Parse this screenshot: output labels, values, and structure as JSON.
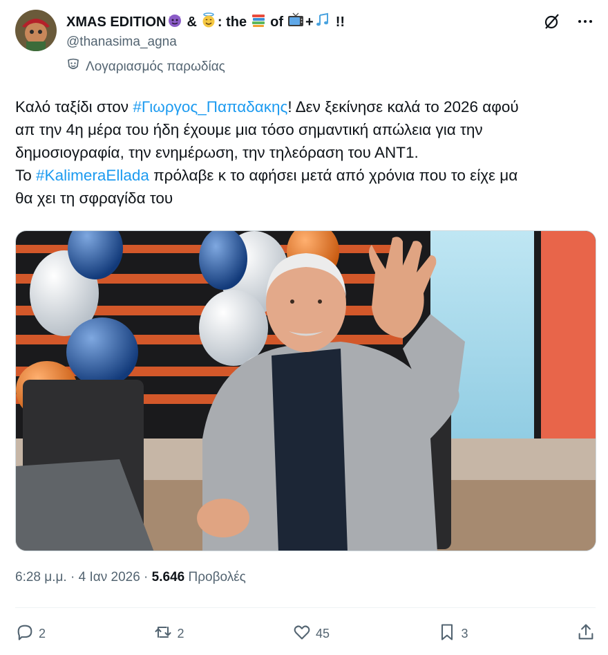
{
  "header": {
    "name_part1": "XMAS EDITION",
    "name_part2": "&",
    "name_part3": ": the",
    "name_part4": "of",
    "name_part5": "+",
    "name_part6": "!!",
    "handle": "@thanasima_agna",
    "parody_label": "Λογαριασμός παρωδίας"
  },
  "tweet": {
    "line1_pre": "Καλό ταξίδι στον ",
    "line1_tag": "#Γιωργος_Παπαδακης",
    "line1_post": "! Δεν ξεκίνησε καλά το 2026 αφού",
    "line2": "απ την 4η μέρα του ήδη έχουμε μια τόσο σημαντική απώλεια για την",
    "line3": "δημοσιογραφία, την ενημέρωση, την τηλεόραση του ΑΝΤ1.",
    "line4_pre": "Το ",
    "line4_tag": "#KalimeraEllada",
    "line4_post": " πρόλαβε κ το αφήσει μετά από χρόνια που το είχε μα",
    "line5": "θα χει τη σφραγίδα του"
  },
  "meta": {
    "time": "6:28 μ.μ.",
    "sep1": " · ",
    "date": "4 Ιαν 2026",
    "sep2": " · ",
    "views": "5.646",
    "views_label": " Προβολές"
  },
  "actions": {
    "replies": "2",
    "reposts": "2",
    "likes": "45",
    "bookmarks": "3"
  },
  "colors": {
    "accent": "#1d9bf0",
    "secondary_text": "#536471"
  }
}
